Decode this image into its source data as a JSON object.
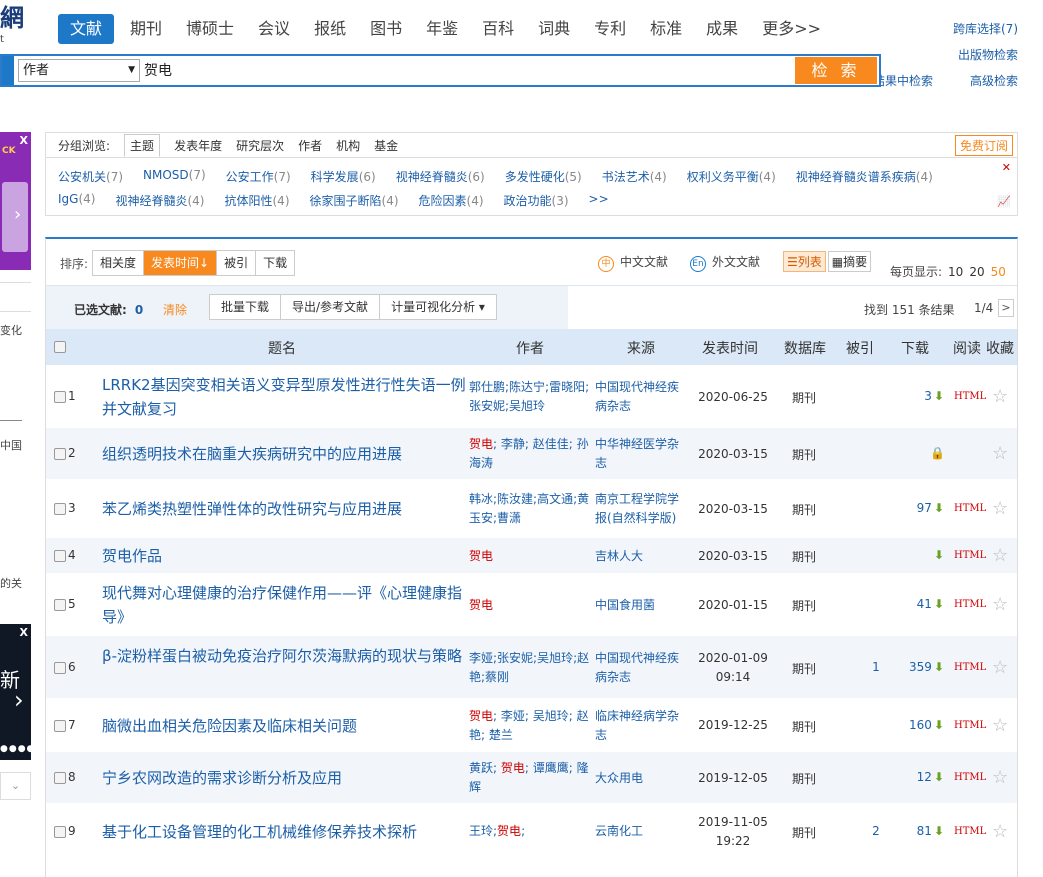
{
  "logo": {
    "text": "網",
    "sub": "t"
  },
  "nav": {
    "tabs": [
      "文献",
      "期刊",
      "博硕士",
      "会议",
      "报纸",
      "图书",
      "年鉴",
      "百科",
      "词典",
      "专利",
      "标准",
      "成果",
      "更多>>"
    ]
  },
  "right_links": {
    "cross": "跨库选择(7)",
    "publication": "出版物检索",
    "in_results": "结果中检索",
    "advanced": "高级检索"
  },
  "search": {
    "field": "作者",
    "query": "贺电",
    "button": "检 索"
  },
  "side": {
    "t1": "变化",
    "t2": "中国",
    "t3": "的关",
    "ad1": "CK",
    "ad2": "新"
  },
  "facet": {
    "label": "分组浏览:",
    "tabs": [
      "主题",
      "发表年度",
      "研究层次",
      "作者",
      "机构",
      "基金"
    ],
    "subscribe": "免费订阅",
    "row1": [
      [
        "公安机关",
        "(7)"
      ],
      [
        "NMOSD",
        "(7)"
      ],
      [
        "公安工作",
        "(7)"
      ],
      [
        "科学发展",
        "(6)"
      ],
      [
        "视神经脊髓炎",
        "(6)"
      ],
      [
        "多发性硬化",
        "(5)"
      ],
      [
        "书法艺术",
        "(4)"
      ],
      [
        "权利义务平衡",
        "(4)"
      ],
      [
        "视神经脊髓炎谱系疾病",
        "(4)"
      ]
    ],
    "row2": [
      [
        "IgG",
        "(4)"
      ],
      [
        "视神经脊髓炎",
        "(4)"
      ],
      [
        "抗体阳性",
        "(4)"
      ],
      [
        "徐家围子断陷",
        "(4)"
      ],
      [
        "危险因素",
        "(4)"
      ],
      [
        "政治功能",
        "(3)"
      ],
      [
        ">>",
        ""
      ]
    ]
  },
  "sort": {
    "label": "排序:",
    "options": [
      "相关度",
      "发表时间↓",
      "被引",
      "下载"
    ],
    "chinese": "中文文献",
    "foreign": "外文文献",
    "list": "☰列表",
    "abstract": "▦摘要",
    "pagesize_label": "每页显示:",
    "sizes": [
      "10",
      "20",
      "50"
    ]
  },
  "toolbar": {
    "selected_label": "已选文献:",
    "selected_count": "0",
    "clear": "清除",
    "buttons": [
      "批量下载",
      "导出/参考文献",
      "计量可视化分析 ▾"
    ],
    "found": "找到 151 条结果",
    "page": "1/4",
    "next": ">"
  },
  "columns": {
    "title": "题名",
    "author": "作者",
    "source": "来源",
    "date": "发表时间",
    "db": "数据库",
    "cite": "被引",
    "download": "下载",
    "read": "阅读",
    "fav": "收藏"
  },
  "rows": [
    {
      "num": "1",
      "title": "LRRK2基因突变相关语义变异型原发性进行性失语一例并文献复习",
      "author": "郭仕鹏;陈达宁;雷晓阳;张安妮;吴旭玲",
      "source": "中国现代神经疾病杂志",
      "date": "2020-06-25",
      "db": "期刊",
      "cite": "",
      "dl": "3",
      "read": "HTML"
    },
    {
      "num": "2",
      "title": "组织透明技术在脑重大疾病研究中的应用进展",
      "author": "贺电; 李静; 赵佳佳; 孙海涛",
      "source": "中华神经医学杂志",
      "date": "2020-03-15",
      "db": "期刊",
      "cite": "",
      "dl": "",
      "read": ""
    },
    {
      "num": "3",
      "title": "苯乙烯类热塑性弹性体的改性研究与应用进展",
      "author": "韩冰;陈汝建;高文通;黄玉安;曹潇",
      "source": "南京工程学院学报(自然科学版)",
      "date": "2020-03-15",
      "db": "期刊",
      "cite": "",
      "dl": "97",
      "read": "HTML"
    },
    {
      "num": "4",
      "title": "贺电作品",
      "author": "贺电",
      "source": "吉林人大",
      "date": "2020-03-15",
      "db": "期刊",
      "cite": "",
      "dl": "",
      "read": "HTML"
    },
    {
      "num": "5",
      "title": "现代舞对心理健康的治疗保健作用——评《心理健康指导》",
      "author": "贺电",
      "source": "中国食用菌",
      "date": "2020-01-15",
      "db": "期刊",
      "cite": "",
      "dl": "41",
      "read": "HTML"
    },
    {
      "num": "6",
      "title": "β-淀粉样蛋白被动免疫治疗阿尔茨海默病的现状与策略",
      "author": "李娅;张安妮;吴旭玲;赵艳;蔡刚",
      "source": "中国现代神经疾病杂志",
      "date": "2020-01-09 09:14",
      "db": "期刊",
      "cite": "1",
      "dl": "359",
      "read": "HTML"
    },
    {
      "num": "7",
      "title": "脑微出血相关危险因素及临床相关问题",
      "author": "贺电; 李娅; 吴旭玲; 赵艳; 楚兰",
      "source": "临床神经病学杂志",
      "date": "2019-12-25",
      "db": "期刊",
      "cite": "",
      "dl": "160",
      "read": "HTML"
    },
    {
      "num": "8",
      "title": "宁乡农网改造的需求诊断分析及应用",
      "author": "黄跃; 贺电; 谭鹰鹰; 隆辉",
      "source": "大众用电",
      "date": "2019-12-05",
      "db": "期刊",
      "cite": "",
      "dl": "12",
      "read": "HTML"
    },
    {
      "num": "9",
      "title": "基于化工设备管理的化工机械维修保养技术探析",
      "author": "王玲;贺电;",
      "source": "云南化工",
      "date": "2019-11-05 19:22",
      "db": "期刊",
      "cite": "2",
      "dl": "81",
      "read": "HTML"
    }
  ]
}
